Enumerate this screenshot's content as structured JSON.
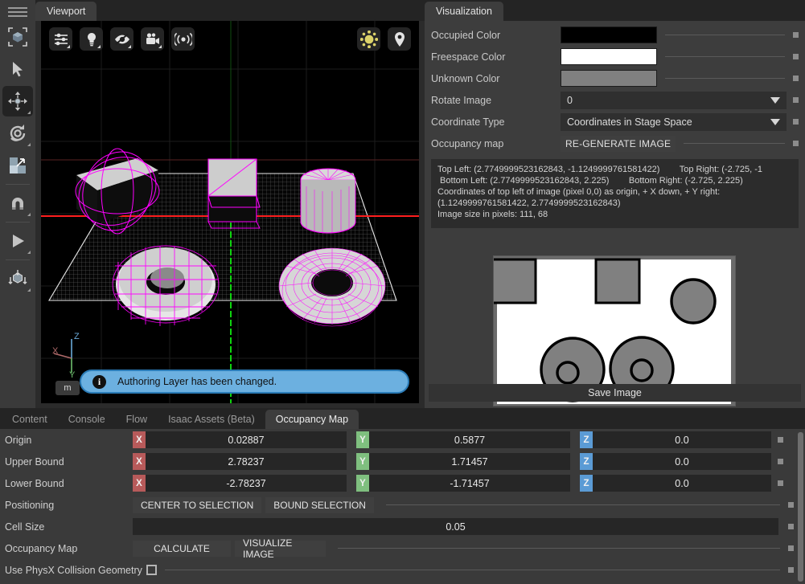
{
  "viewport": {
    "tab_label": "Viewport",
    "toolbar_icons": [
      {
        "name": "viewport-settings-icon",
        "label": "settings-sliders"
      },
      {
        "name": "lighting-icon",
        "label": "light-bulb"
      },
      {
        "name": "visibility-eye-icon",
        "label": "eye"
      },
      {
        "name": "camera-icon",
        "label": "camera"
      },
      {
        "name": "sensor-icon",
        "label": "sensors"
      }
    ],
    "toolbar_right_icons": [
      {
        "name": "sun-gizmo-icon",
        "label": "sun",
        "color": "#d8d06a"
      },
      {
        "name": "map-pin-icon",
        "label": "location-pin"
      }
    ],
    "notification": {
      "text": "Authoring Layer has been changed.",
      "icon": "info-icon",
      "bg_color": "#6cb0e0"
    },
    "gizmo": {
      "z_label": "Z",
      "x_label": "X",
      "y_label": "Y",
      "unit": "m",
      "x_color": "#b06a6a",
      "y_color": "#6fbf6f",
      "z_color": "#6aa9d8"
    },
    "scene": {
      "grid_color": "#d0d0d0",
      "collision_wire_color": "#ff00ff",
      "x_axis_color": "#ff2020",
      "y_axis_color": "#00d000"
    }
  },
  "tool_rail": {
    "hamburger": "menu-icon",
    "tools": [
      {
        "name": "select-bound-tool",
        "active": false
      },
      {
        "name": "cursor-select-tool",
        "active": false
      },
      {
        "name": "move-tool",
        "active": true
      },
      {
        "name": "rotate-tool",
        "active": false
      },
      {
        "name": "scale-tool",
        "active": false
      },
      {
        "name": "snap-magnet-tool",
        "active": false
      },
      {
        "name": "play-tool",
        "active": false
      },
      {
        "name": "physics-drop-tool",
        "active": false
      }
    ]
  },
  "visualization": {
    "tab_label": "Visualization",
    "rows": [
      {
        "label": "Occupied Color",
        "type": "color",
        "value": "#000000"
      },
      {
        "label": "Freespace Color",
        "type": "color",
        "value": "#ffffff"
      },
      {
        "label": "Unknown Color",
        "type": "color",
        "value": "#808080"
      },
      {
        "label": "Rotate Image",
        "type": "combo",
        "value": "0"
      },
      {
        "label": "Coordinate Type",
        "type": "combo",
        "value": "Coordinates in Stage Space"
      },
      {
        "label": "Occupancy map",
        "type": "button",
        "value": "RE-GENERATE IMAGE"
      }
    ],
    "info_text": "Top Left: (2.7749999523162843, -1.1249999761581422)        Top Right: (-2.725, -1\n Bottom Left: (2.7749999523162843, 2.225)        Bottom Right: (-2.725, 2.225)\nCoordinates of top left of image (pixel 0,0) as origin, + X down, + Y right:\n(1.1249999761581422, 2.7749999523162843)\nImage size in pixels: 111, 68",
    "save_button": "Save Image",
    "map_preview": {
      "occupied_color": "#000000",
      "freespace_color": "#ffffff",
      "unknown_color": "#808080"
    }
  },
  "bottom_panel": {
    "tabs": [
      {
        "label": "Content",
        "active": false
      },
      {
        "label": "Console",
        "active": false
      },
      {
        "label": "Flow",
        "active": false
      },
      {
        "label": "Isaac Assets (Beta)",
        "active": false
      },
      {
        "label": "Occupancy Map",
        "active": true
      }
    ],
    "vector_rows": [
      {
        "label": "Origin",
        "x": "0.02887",
        "y": "0.5877",
        "z": "0.0"
      },
      {
        "label": "Upper Bound",
        "x": "2.78237",
        "y": "1.71457",
        "z": "0.0"
      },
      {
        "label": "Lower Bound",
        "x": "-2.78237",
        "y": "-1.71457",
        "z": "0.0"
      }
    ],
    "axis_labels": {
      "x": "X",
      "y": "Y",
      "z": "Z"
    },
    "positioning": {
      "label": "Positioning",
      "buttons": [
        "CENTER TO SELECTION",
        "BOUND SELECTION"
      ]
    },
    "cell_size": {
      "label": "Cell Size",
      "value": "0.05"
    },
    "occupancy_map": {
      "label": "Occupancy Map",
      "buttons": [
        "CALCULATE",
        "VISUALIZE IMAGE"
      ]
    },
    "physx": {
      "label": "Use PhysX Collision Geometry",
      "checked": false
    }
  }
}
